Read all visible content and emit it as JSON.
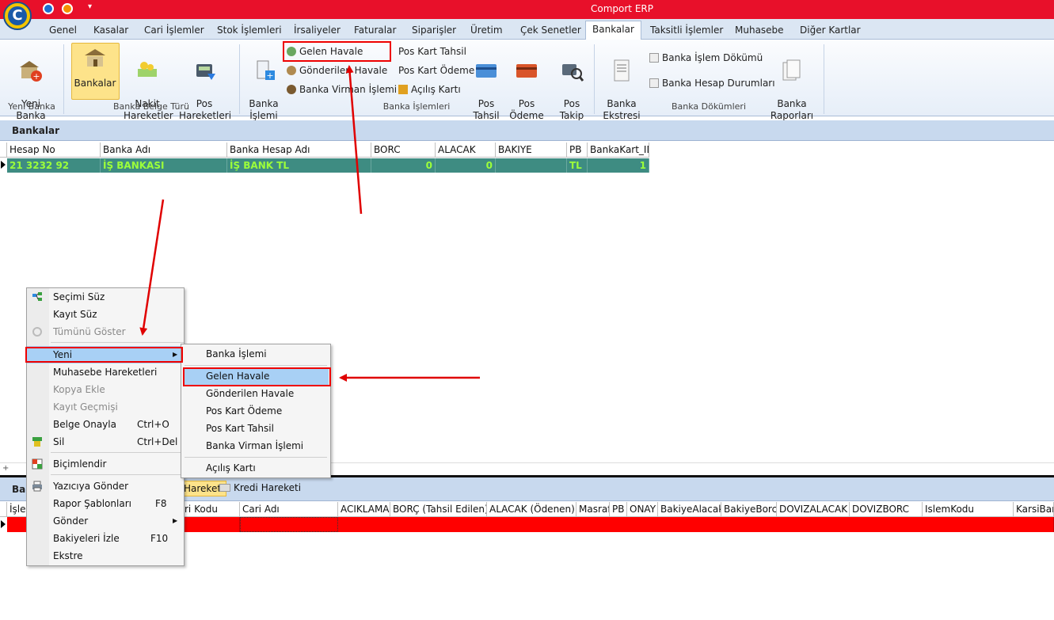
{
  "app": {
    "title": "Comport ERP",
    "logo_letter": "C"
  },
  "tabs": [
    "Genel",
    "Kasalar",
    "Cari İşlemler",
    "Stok İşlemleri",
    "İrsaliyeler",
    "Faturalar",
    "Siparişler",
    "Üretim",
    "Çek Senetler",
    "Bankalar",
    "Taksitli İşlemler",
    "Muhasebe",
    "Diğer Kartlar"
  ],
  "active_tab": "Bankalar",
  "ribbon": {
    "yeni_banka_ekle": "Yeni\nBanka Ekle",
    "bankalar": "Bankalar",
    "nakit_hareketler": "Nakit\nHareketler",
    "pos_hareketleri": "Pos\nHareketleri",
    "banka_islemi": "Banka\nİşlemi",
    "gelen_havale": "Gelen Havale",
    "gonderilen_havale": "Gönderilen Havale",
    "banka_virman": "Banka Virman İşlemi",
    "pos_kart_tahsil": "Pos Kart Tahsil",
    "pos_kart_odeme": "Pos Kart Ödeme",
    "acilis_karti": "Açılış Kartı",
    "pos_tahsil": "Pos\nTahsil",
    "pos_odeme": "Pos\nÖdeme",
    "pos_takip": "Pos\nTakip",
    "banka_ekstresi": "Banka\nEkstresi",
    "banka_islem_dokumu": "Banka İşlem Dökümü",
    "banka_hesap_durumlari": "Banka Hesap Durumları",
    "banka_raporlari": "Banka\nRaporları",
    "groups": {
      "yeni_banka": "Yeni Banka",
      "belge_turu": "Banka Belge Türü",
      "islemleri": "Banka İşlemleri",
      "dokumleri": "Banka Dökümleri"
    }
  },
  "banks_panel": {
    "title": "Bankalar",
    "columns": [
      "Hesap No",
      "Banka Adı",
      "Banka Hesap Adı",
      "BORC",
      "ALACAK",
      "BAKIYE",
      "PB",
      "BankaKart_ID"
    ],
    "row": {
      "hesap_no": "21 3232 92",
      "banka_adi": "İŞ BANKASI",
      "hesap_adi": "İŞ BANK TL",
      "borc": "0",
      "alacak": "0",
      "bakiye": "",
      "pb": "TL",
      "id": "1"
    }
  },
  "bottom_panel": {
    "title_partial": "Ba",
    "tab_partial": "Hareketi",
    "tab_kredi": "Kredi Hareketi",
    "columns": [
      "İşlen",
      "ri Kodu",
      "Cari Adı",
      "ACIKLAMA",
      "BORÇ (Tahsil Edilen)",
      "ALACAK (Ödenen)",
      "Masraf",
      "PB",
      "ONAY",
      "BakiyeAlacak",
      "BakiyeBorc",
      "DOVIZALACAK",
      "DOVIZBORC",
      "IslemKodu",
      "KarsiBank"
    ]
  },
  "context_menu": [
    {
      "label": "Seçimi Süz",
      "shortcut": "",
      "disabled": false,
      "icon": "filter-select-icon"
    },
    {
      "label": "Kayıt Süz",
      "shortcut": "",
      "disabled": false,
      "icon": ""
    },
    {
      "label": "Tümünü Göster",
      "shortcut": "",
      "disabled": true,
      "icon": "show-all-icon"
    },
    {
      "label": "Yeni",
      "shortcut": "",
      "disabled": false,
      "icon": ""
    },
    {
      "label": "Muhasebe Hareketleri",
      "shortcut": "",
      "disabled": false,
      "icon": ""
    },
    {
      "label": "Kopya Ekle",
      "shortcut": "",
      "disabled": true,
      "icon": ""
    },
    {
      "label": "Kayıt Geçmişi",
      "shortcut": "",
      "disabled": true,
      "icon": ""
    },
    {
      "label": "Belge Onayla",
      "shortcut": "Ctrl+O",
      "disabled": false,
      "icon": ""
    },
    {
      "label": "Sil",
      "shortcut": "Ctrl+Del",
      "disabled": false,
      "icon": "delete-icon"
    },
    {
      "label": "Biçimlendir",
      "shortcut": "",
      "disabled": false,
      "icon": "format-icon"
    },
    {
      "label": "Yazıcıya Gönder",
      "shortcut": "",
      "disabled": false,
      "icon": "printer-icon"
    },
    {
      "label": "Rapor Şablonları",
      "shortcut": "F8",
      "disabled": false,
      "icon": ""
    },
    {
      "label": "Gönder",
      "shortcut": "",
      "disabled": false,
      "icon": ""
    },
    {
      "label": "Bakiyeleri İzle",
      "shortcut": "F10",
      "disabled": false,
      "icon": ""
    },
    {
      "label": "Ekstre",
      "shortcut": "",
      "disabled": false,
      "icon": ""
    }
  ],
  "submenu": [
    "Banka İşlemi",
    "Gelen Havale",
    "Gönderilen Havale",
    "Pos Kart Ödeme",
    "Pos Kart Tahsil",
    "Banka Virman İşlemi",
    "Açılış Kartı"
  ],
  "colors": {
    "titlebar": "#e8102a",
    "selected_row": "#3e8c82",
    "selected_text": "#9cff3a",
    "annotation": "#e00000"
  }
}
